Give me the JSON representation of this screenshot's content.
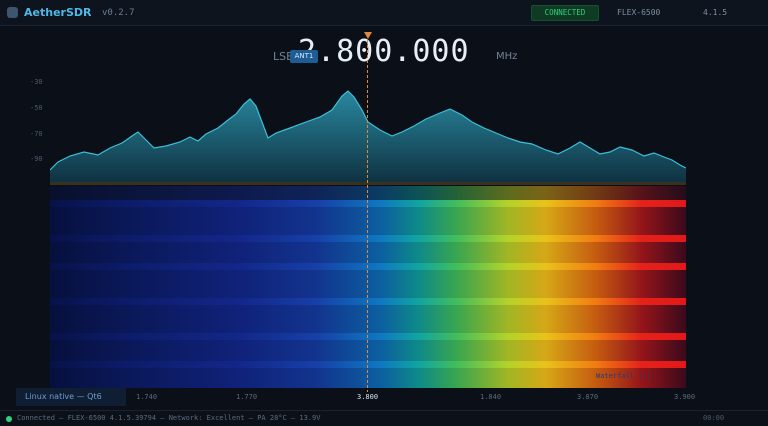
{
  "titlebar": {
    "app_title": "AetherSDR",
    "version": "v0.2.7",
    "status_badge": "CONNECTED",
    "radio_model": "FLEX-6500",
    "firmware_version": "4.1.5"
  },
  "header": {
    "mode": "LSB",
    "frequency": "2.800.000",
    "unit": "MHz",
    "anti_button": "ANT1"
  },
  "spectrum": {
    "db_labels": [
      "-30",
      "-50",
      "-70",
      "-90"
    ],
    "fill_color": "#1b5f73",
    "line_color": "#3bc0d8"
  },
  "waterfall": {
    "label": "Waterfall 1:1"
  },
  "axis": {
    "labels": [
      "1.740",
      "1.770",
      "3.800",
      "1.840",
      "3.870",
      "3.900"
    ],
    "center_index": 2
  },
  "os_tag": "Linux native — Qt6",
  "statusbar": {
    "text": "Connected — FLEX-6500 4.1.5.39794 — Network: Excellent — PA 28°C — 13.9V",
    "right": "00:00"
  },
  "colors": {
    "accent": "#4fb8e8",
    "connected": "#2ed37a",
    "marker": "#e0893a"
  }
}
